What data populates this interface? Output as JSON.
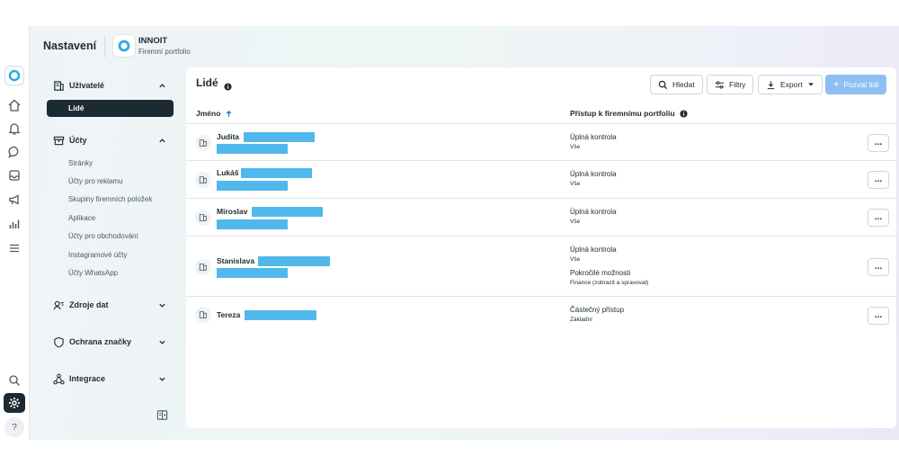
{
  "header": {
    "title": "Nastavení",
    "business_name": "INNOIT",
    "business_type": "Firemní portfolio"
  },
  "sidebar": {
    "users_label": "Uživatelé",
    "people_label": "Lidé",
    "accounts_label": "Účty",
    "accounts_items": [
      "Stránky",
      "Účty pro reklamu",
      "Skupiny firemních položek",
      "Aplikace",
      "Účty pro obchodování",
      "Instagramové účty",
      "Účty WhatsApp"
    ],
    "data_sources_label": "Zdroje dat",
    "brand_safety_label": "Ochrana značky",
    "integrations_label": "Integrace"
  },
  "panel": {
    "title": "Lidé",
    "search_label": "Hledat",
    "filters_label": "Filtry",
    "export_label": "Export",
    "invite_label": "Pozvat lidi",
    "col_name": "Jméno",
    "col_access": "Přístup k firemnímu portfoliu",
    "more_label": "..."
  },
  "rows": [
    {
      "name": "Judita",
      "access": "Úplná kontrola",
      "access_sub": "Vše"
    },
    {
      "name": "Lukáš",
      "access": "Úplná kontrola",
      "access_sub": "Vše"
    },
    {
      "name": "Miroslav",
      "access": "Úplná kontrola",
      "access_sub": "Vše"
    },
    {
      "name": "Stanislava",
      "access": "Úplná kontrola",
      "access_sub": "Vše",
      "access2": "Pokročilé možnosti",
      "access2_sub": "Finance (zobrazit a spravovat)"
    },
    {
      "name": "Tereza",
      "access": "Částečný přístup",
      "access_sub": "Základní"
    }
  ],
  "colors": {
    "accent": "#0866ff",
    "redaction": "#50b8ec",
    "selected_bg": "#1c2b33",
    "invite_bg": "#8fbff0"
  },
  "icons": [
    "meta-logo-icon",
    "business-logo-icon",
    "home-icon",
    "bell-icon",
    "chat-icon",
    "inbox-icon",
    "megaphone-icon",
    "chart-icon",
    "menu-icon",
    "search-icon",
    "gear-icon",
    "help-icon",
    "info-icon",
    "filter-icon",
    "download-icon",
    "plus-icon",
    "building-icon",
    "person-badge-icon"
  ]
}
